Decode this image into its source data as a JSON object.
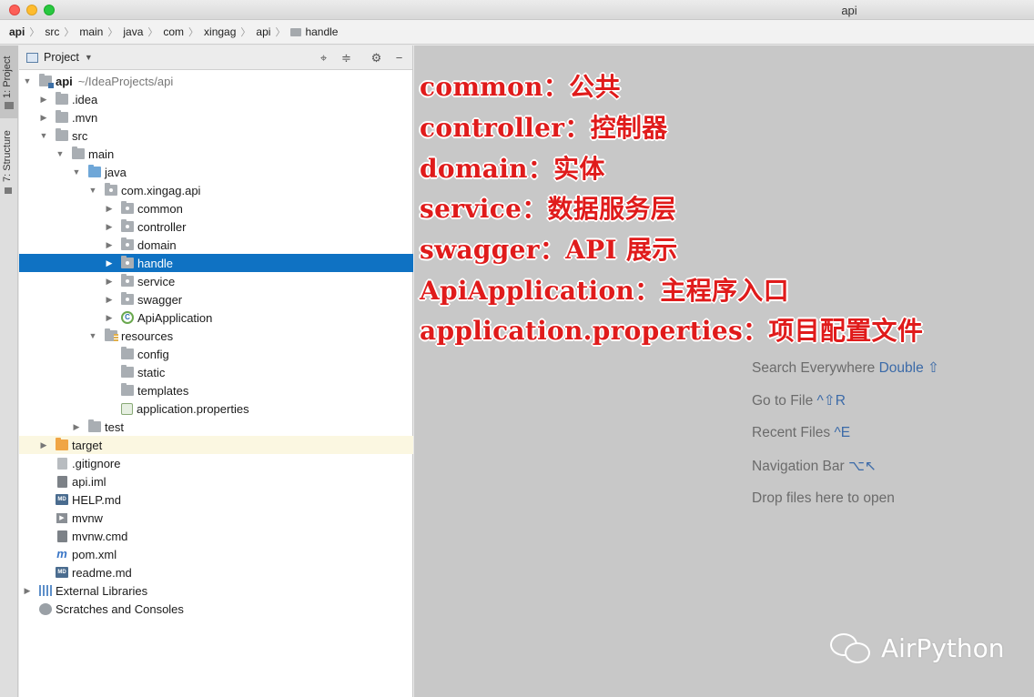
{
  "window": {
    "title": "api"
  },
  "breadcrumbs": [
    "api",
    "src",
    "main",
    "java",
    "com",
    "xingag",
    "api",
    "handle"
  ],
  "sidebar_tabs": {
    "project": "1: Project",
    "structure": "7: Structure"
  },
  "panel": {
    "title": "Project"
  },
  "tree": [
    {
      "label": "api",
      "sub": "~/IdeaProjects/api",
      "icon": "module",
      "arrow": "open",
      "bold": true
    },
    {
      "label": ".idea",
      "icon": "folder",
      "arrow": "closed"
    },
    {
      "label": ".mvn",
      "icon": "folder",
      "arrow": "closed"
    },
    {
      "label": "src",
      "icon": "folder",
      "arrow": "open"
    },
    {
      "label": "main",
      "icon": "folder",
      "arrow": "open"
    },
    {
      "label": "java",
      "icon": "folder-blue",
      "arrow": "open"
    },
    {
      "label": "com.xingag.api",
      "icon": "package",
      "arrow": "open"
    },
    {
      "label": "common",
      "icon": "package",
      "arrow": "closed"
    },
    {
      "label": "controller",
      "icon": "package",
      "arrow": "closed"
    },
    {
      "label": "domain",
      "icon": "package",
      "arrow": "closed"
    },
    {
      "label": "handle",
      "icon": "package",
      "arrow": "closed",
      "selected": true
    },
    {
      "label": "service",
      "icon": "package",
      "arrow": "closed"
    },
    {
      "label": "swagger",
      "icon": "package",
      "arrow": "closed"
    },
    {
      "label": "ApiApplication",
      "icon": "spring-class",
      "arrow": "closed"
    },
    {
      "label": "resources",
      "icon": "resources-folder",
      "arrow": "open"
    },
    {
      "label": "config",
      "icon": "folder",
      "arrow": "none"
    },
    {
      "label": "static",
      "icon": "folder",
      "arrow": "none"
    },
    {
      "label": "templates",
      "icon": "folder",
      "arrow": "none"
    },
    {
      "label": "application.properties",
      "icon": "properties-file",
      "arrow": "none"
    },
    {
      "label": "test",
      "icon": "folder",
      "arrow": "closed"
    },
    {
      "label": "target",
      "icon": "folder-orange",
      "arrow": "closed",
      "highlight": true
    },
    {
      "label": ".gitignore",
      "icon": "file",
      "arrow": "none"
    },
    {
      "label": "api.iml",
      "icon": "file-dark",
      "arrow": "none"
    },
    {
      "label": "HELP.md",
      "icon": "markdown-file",
      "arrow": "none"
    },
    {
      "label": "mvnw",
      "icon": "terminal-file",
      "arrow": "none"
    },
    {
      "label": "mvnw.cmd",
      "icon": "file-dark",
      "arrow": "none"
    },
    {
      "label": "pom.xml",
      "icon": "maven-file",
      "arrow": "none"
    },
    {
      "label": "readme.md",
      "icon": "markdown-file",
      "arrow": "none"
    },
    {
      "label": "External Libraries",
      "icon": "libraries",
      "arrow": "closed"
    },
    {
      "label": "Scratches and Consoles",
      "icon": "scratches",
      "arrow": "none"
    }
  ],
  "annotations": [
    "common：公共",
    "controller：控制器",
    "domain：实体",
    "service：数据服务层",
    "swagger：API 展示",
    "ApiApplication：主程序入口",
    "application.properties：项目配置文件"
  ],
  "editor_hints": [
    {
      "text": "Search Everywhere",
      "key": "Double ⇧"
    },
    {
      "text": "Go to File",
      "key": "^⇧R"
    },
    {
      "text": "Recent Files",
      "key": "^E"
    },
    {
      "text": "Navigation Bar",
      "key": "⌥↖"
    },
    {
      "text": "Drop files here to open",
      "key": ""
    }
  ],
  "watermark": {
    "text": "AirPython"
  },
  "colors": {
    "selection": "#0f72c3",
    "annotation": "#e01b1b",
    "editor_bg": "#c8c8c8",
    "hint_key": "#3b6aa8"
  }
}
